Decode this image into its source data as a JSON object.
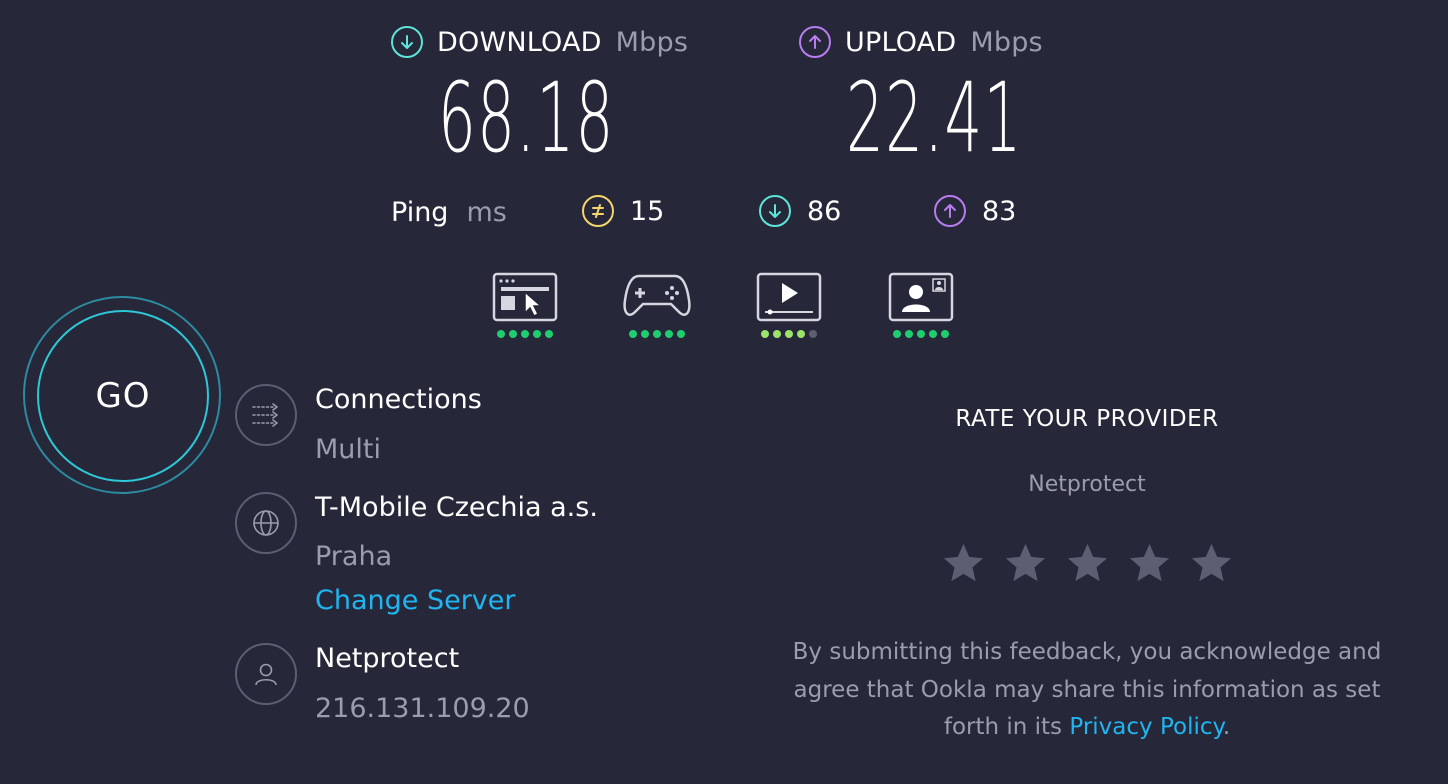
{
  "download": {
    "title": "DOWNLOAD",
    "unit": "Mbps",
    "value": "68.18",
    "icon": "arrow-down-circle-icon",
    "color": "#5ce5d8"
  },
  "upload": {
    "title": "UPLOAD",
    "unit": "Mbps",
    "value": "22.41",
    "icon": "arrow-up-circle-icon",
    "color": "#b97cf0"
  },
  "ping": {
    "label": "Ping",
    "unit": "ms",
    "idle": "15",
    "download": "86",
    "upload": "83",
    "idle_color": "#f5d56c"
  },
  "quality": [
    {
      "name": "browsing",
      "icon": "web-browsing-icon",
      "score": 5,
      "max": 5
    },
    {
      "name": "gaming",
      "icon": "gamepad-icon",
      "score": 5,
      "max": 5
    },
    {
      "name": "streaming",
      "icon": "video-streaming-icon",
      "score": 4,
      "max": 5
    },
    {
      "name": "video-chat",
      "icon": "video-chat-icon",
      "score": 5,
      "max": 5
    }
  ],
  "go_label": "GO",
  "connections": {
    "title": "Connections",
    "value": "Multi"
  },
  "server": {
    "title": "T-Mobile Czechia a.s.",
    "location": "Praha",
    "change_label": "Change Server"
  },
  "provider": {
    "title": "Netprotect",
    "ip": "216.131.109.20"
  },
  "rate": {
    "title": "RATE YOUR PROVIDER",
    "provider": "Netprotect",
    "disclaimer_line1": "By submitting this feedback, you acknowledge and",
    "disclaimer_line2": "agree that Ookla may share this information as set",
    "disclaimer_pre": "forth in its ",
    "privacy_link": "Privacy Policy",
    "disclaimer_post": "."
  },
  "colors": {
    "background": "#262739",
    "accent_link": "#1fb5f0",
    "dot_green": "#1fce6f",
    "dot_light": "#9be36a",
    "dot_off": "#5d5e72"
  }
}
